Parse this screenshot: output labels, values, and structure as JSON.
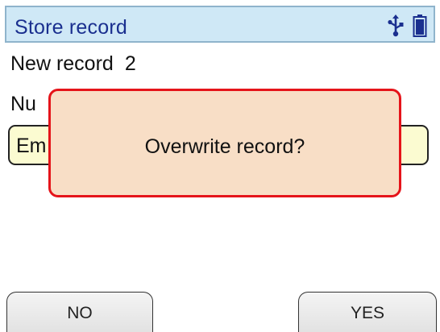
{
  "header": {
    "title": "Store record",
    "icons": [
      "usb-icon",
      "battery-icon"
    ],
    "colors": {
      "title_text": "#1a2f8f",
      "title_bg": "#cfe8f6"
    }
  },
  "content": {
    "new_record_label": "New record",
    "new_record_value": "2",
    "number_label_partial": "Nu",
    "field_partial_text": "Em"
  },
  "dialog": {
    "message": "Overwrite record?",
    "colors": {
      "bg": "#f8dec6",
      "border": "#e5141a"
    }
  },
  "softkeys": {
    "left_label": "NO",
    "right_label": "YES"
  }
}
